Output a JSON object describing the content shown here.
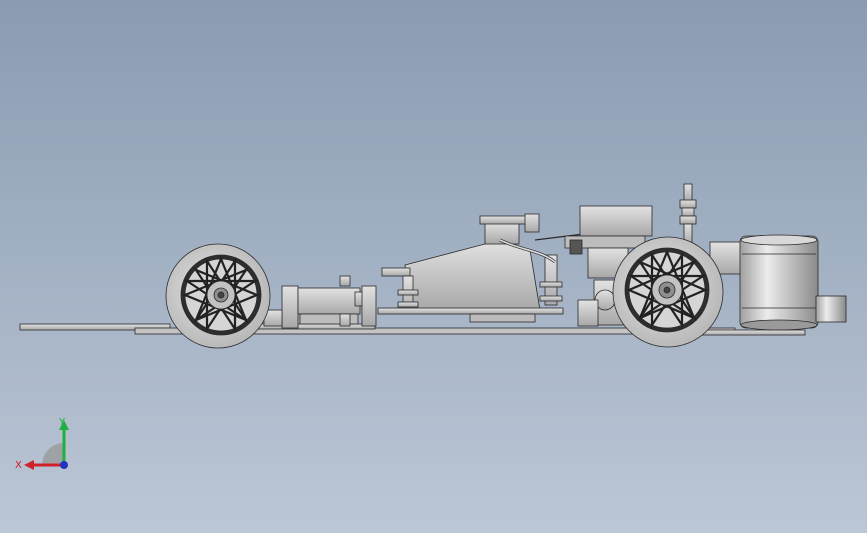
{
  "viewport": {
    "background_top": "#8a9bb2",
    "background_bottom": "#bcc7d6"
  },
  "model": {
    "view": "side-elevation",
    "subject": "rc-car-chassis",
    "part_color": "#c9c9c9",
    "edge_color": "#2a2a2a"
  },
  "triad": {
    "x_label": "X",
    "y_label": "Y",
    "x_color": "#d0202a",
    "y_color": "#20b040",
    "z_color": "#2030c0"
  }
}
